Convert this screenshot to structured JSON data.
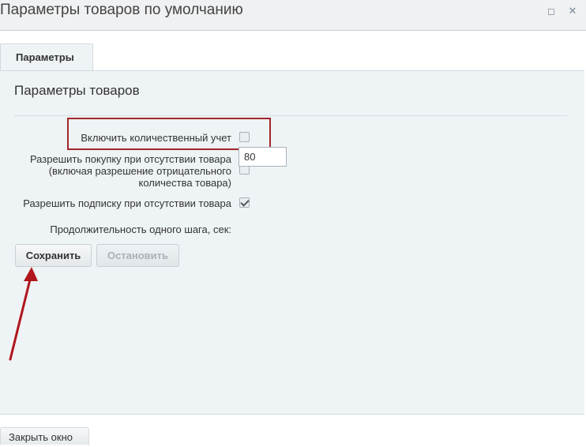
{
  "window": {
    "title": "Параметры товаров по умолчанию",
    "maximize_icon": "maximize-icon",
    "close_icon": "close-icon"
  },
  "tabs": [
    {
      "label": "Параметры",
      "active": true
    }
  ],
  "section": {
    "title": "Параметры товаров"
  },
  "fields": {
    "quantity_tracking": {
      "label": "Включить количественный учет",
      "checked": false
    },
    "allow_purchase": {
      "label_lines": [
        "Разрешить покупку при отсутствии товара",
        "(включая разрешение отрицательного",
        "количества товара)"
      ],
      "checked": false
    },
    "allow_subscribe": {
      "label": "Разрешить подписку при отсутствии товара",
      "checked": true
    },
    "step_duration": {
      "label": "Продолжительность одного шага, сек:",
      "value": "80"
    }
  },
  "buttons": {
    "save": "Сохранить",
    "stop": "Остановить",
    "close_window": "Закрыть окно"
  },
  "colors": {
    "highlight_border": "#a3272b",
    "arrow": "#b0161b",
    "panel_bg": "#eef3f5"
  }
}
